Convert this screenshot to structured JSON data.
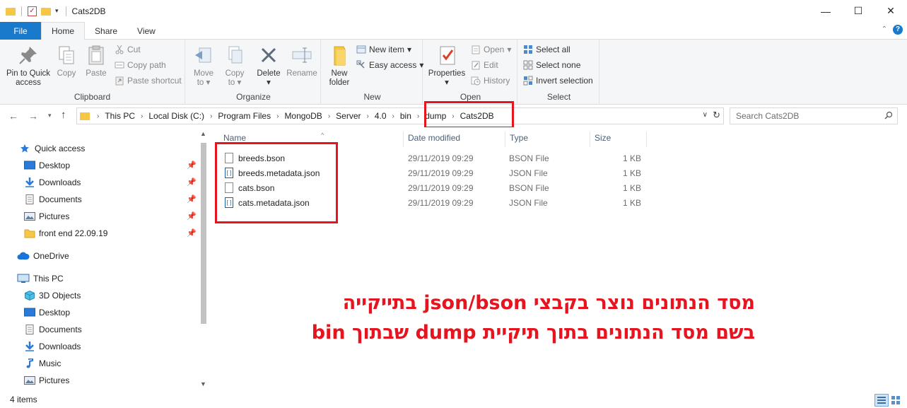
{
  "window": {
    "title": "Cats2DB",
    "controls": {
      "minimize": "—",
      "maximize": "☐",
      "close": "✕"
    }
  },
  "tabs": [
    {
      "label": "File"
    },
    {
      "label": "Home"
    },
    {
      "label": "Share"
    },
    {
      "label": "View"
    }
  ],
  "ribbon": {
    "clipboard": {
      "label": "Clipboard",
      "pin": "Pin to Quick access",
      "pin_line1": "Pin to Quick",
      "pin_line2": "access",
      "copy": "Copy",
      "paste": "Paste",
      "cut": "Cut",
      "copy_path": "Copy path",
      "paste_shortcut": "Paste shortcut"
    },
    "organize": {
      "label": "Organize",
      "move_to": "Move",
      "move_to_2": "to",
      "copy_to": "Copy",
      "copy_to_2": "to",
      "delete": "Delete",
      "rename": "Rename"
    },
    "new": {
      "label": "New",
      "new_folder_1": "New",
      "new_folder_2": "folder",
      "new_item": "New item",
      "easy_access": "Easy access"
    },
    "open": {
      "label": "Open",
      "properties": "Properties",
      "open": "Open",
      "edit": "Edit",
      "history": "History"
    },
    "select": {
      "label": "Select",
      "select_all": "Select all",
      "select_none": "Select none",
      "invert": "Invert selection"
    }
  },
  "address": {
    "crumbs": [
      "This PC",
      "Local Disk (C:)",
      "Program Files",
      "MongoDB",
      "Server",
      "4.0",
      "bin",
      "dump",
      "Cats2DB"
    ]
  },
  "search": {
    "placeholder": "Search Cats2DB"
  },
  "nav": {
    "quick_access": "Quick access",
    "items": [
      {
        "label": "Desktop"
      },
      {
        "label": "Downloads"
      },
      {
        "label": "Documents"
      },
      {
        "label": "Pictures"
      },
      {
        "label": "front end 22.09.19"
      }
    ],
    "onedrive": "OneDrive",
    "this_pc": "This PC",
    "pc_items": [
      {
        "label": "3D Objects"
      },
      {
        "label": "Desktop"
      },
      {
        "label": "Documents"
      },
      {
        "label": "Downloads"
      },
      {
        "label": "Music"
      },
      {
        "label": "Pictures"
      }
    ]
  },
  "columns": {
    "name": "Name",
    "date": "Date modified",
    "type": "Type",
    "size": "Size"
  },
  "files": [
    {
      "name": "breeds.bson",
      "date": "29/11/2019 09:29",
      "type": "BSON File",
      "size": "1 KB"
    },
    {
      "name": "breeds.metadata.json",
      "date": "29/11/2019 09:29",
      "type": "JSON File",
      "size": "1 KB"
    },
    {
      "name": "cats.bson",
      "date": "29/11/2019 09:29",
      "type": "BSON File",
      "size": "1 KB"
    },
    {
      "name": "cats.metadata.json",
      "date": "29/11/2019 09:29",
      "type": "JSON File",
      "size": "1 KB"
    }
  ],
  "annotation": {
    "line1": "מסד הנתונים נוצר בקבצי json/bson בתייקייה",
    "line2": "בשם מסד הנתונים בתוך תיקיית dump שבתוך bin"
  },
  "status": {
    "items": "4 items"
  },
  "colors": {
    "accent": "#1979ca",
    "highlight": "#e5141e"
  }
}
